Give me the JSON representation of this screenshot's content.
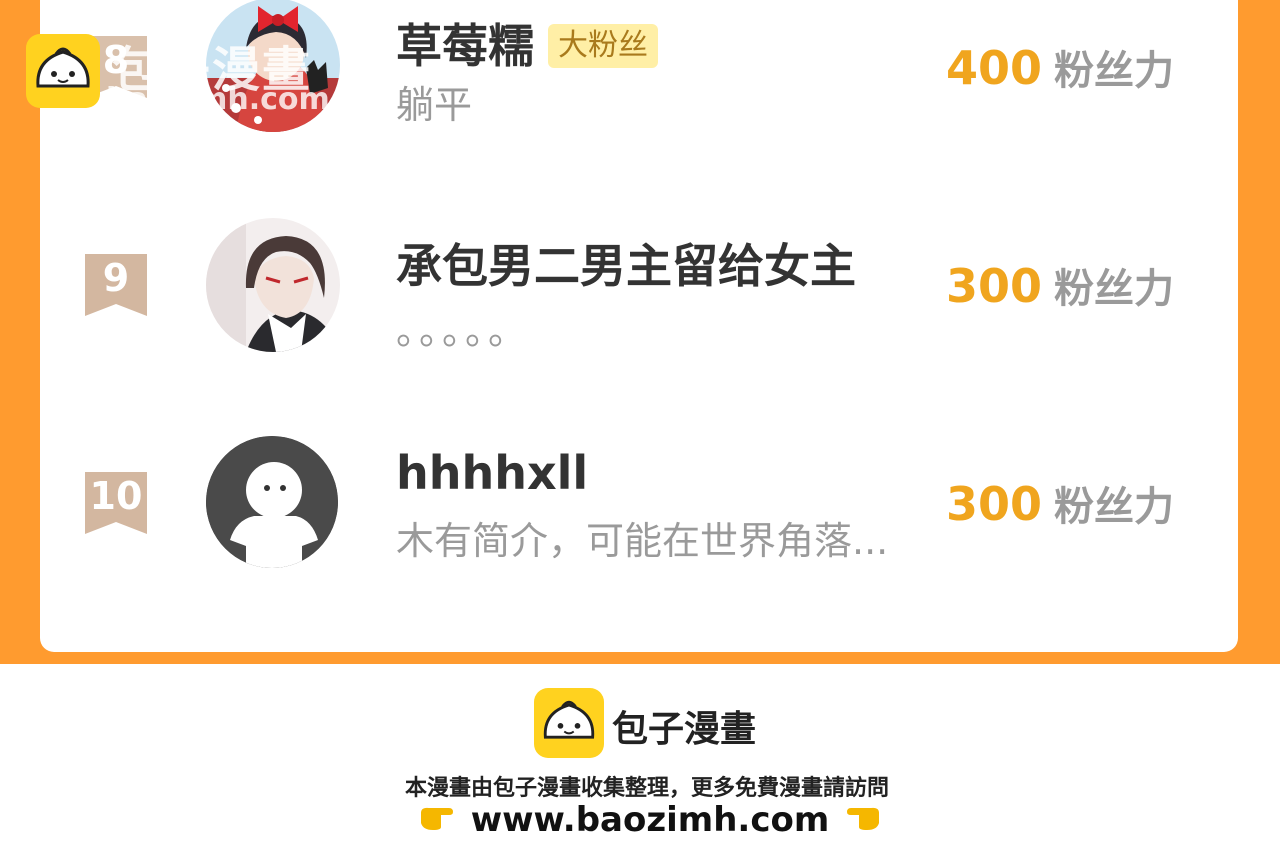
{
  "ranking": {
    "items": [
      {
        "rank": "8",
        "name": "草莓糯",
        "badge": "大粉丝",
        "bio": "躺平",
        "score": "400",
        "unit": "粉丝力"
      },
      {
        "rank": "9",
        "name": "承包男二男主留给女主",
        "badge": "",
        "bio": "。。。。。",
        "score": "300",
        "unit": "粉丝力"
      },
      {
        "rank": "10",
        "name": "hhhhxll",
        "badge": "",
        "bio": "木有简介，可能在世界角落...",
        "score": "300",
        "unit": "粉丝力"
      }
    ]
  },
  "watermark": {
    "brand": "包子漫畫",
    "url": "baozimh.com"
  },
  "footer": {
    "brand": "包子漫畫",
    "description": "本漫畫由包子漫畫收集整理，更多免費漫畫請訪問",
    "url": "www.baozimh.com"
  },
  "colors": {
    "orange": "#FF9B2F",
    "score": "#F0A51E",
    "badge_bg": "#FFEFA6",
    "rank_ribbon": "#D3B7A0"
  }
}
